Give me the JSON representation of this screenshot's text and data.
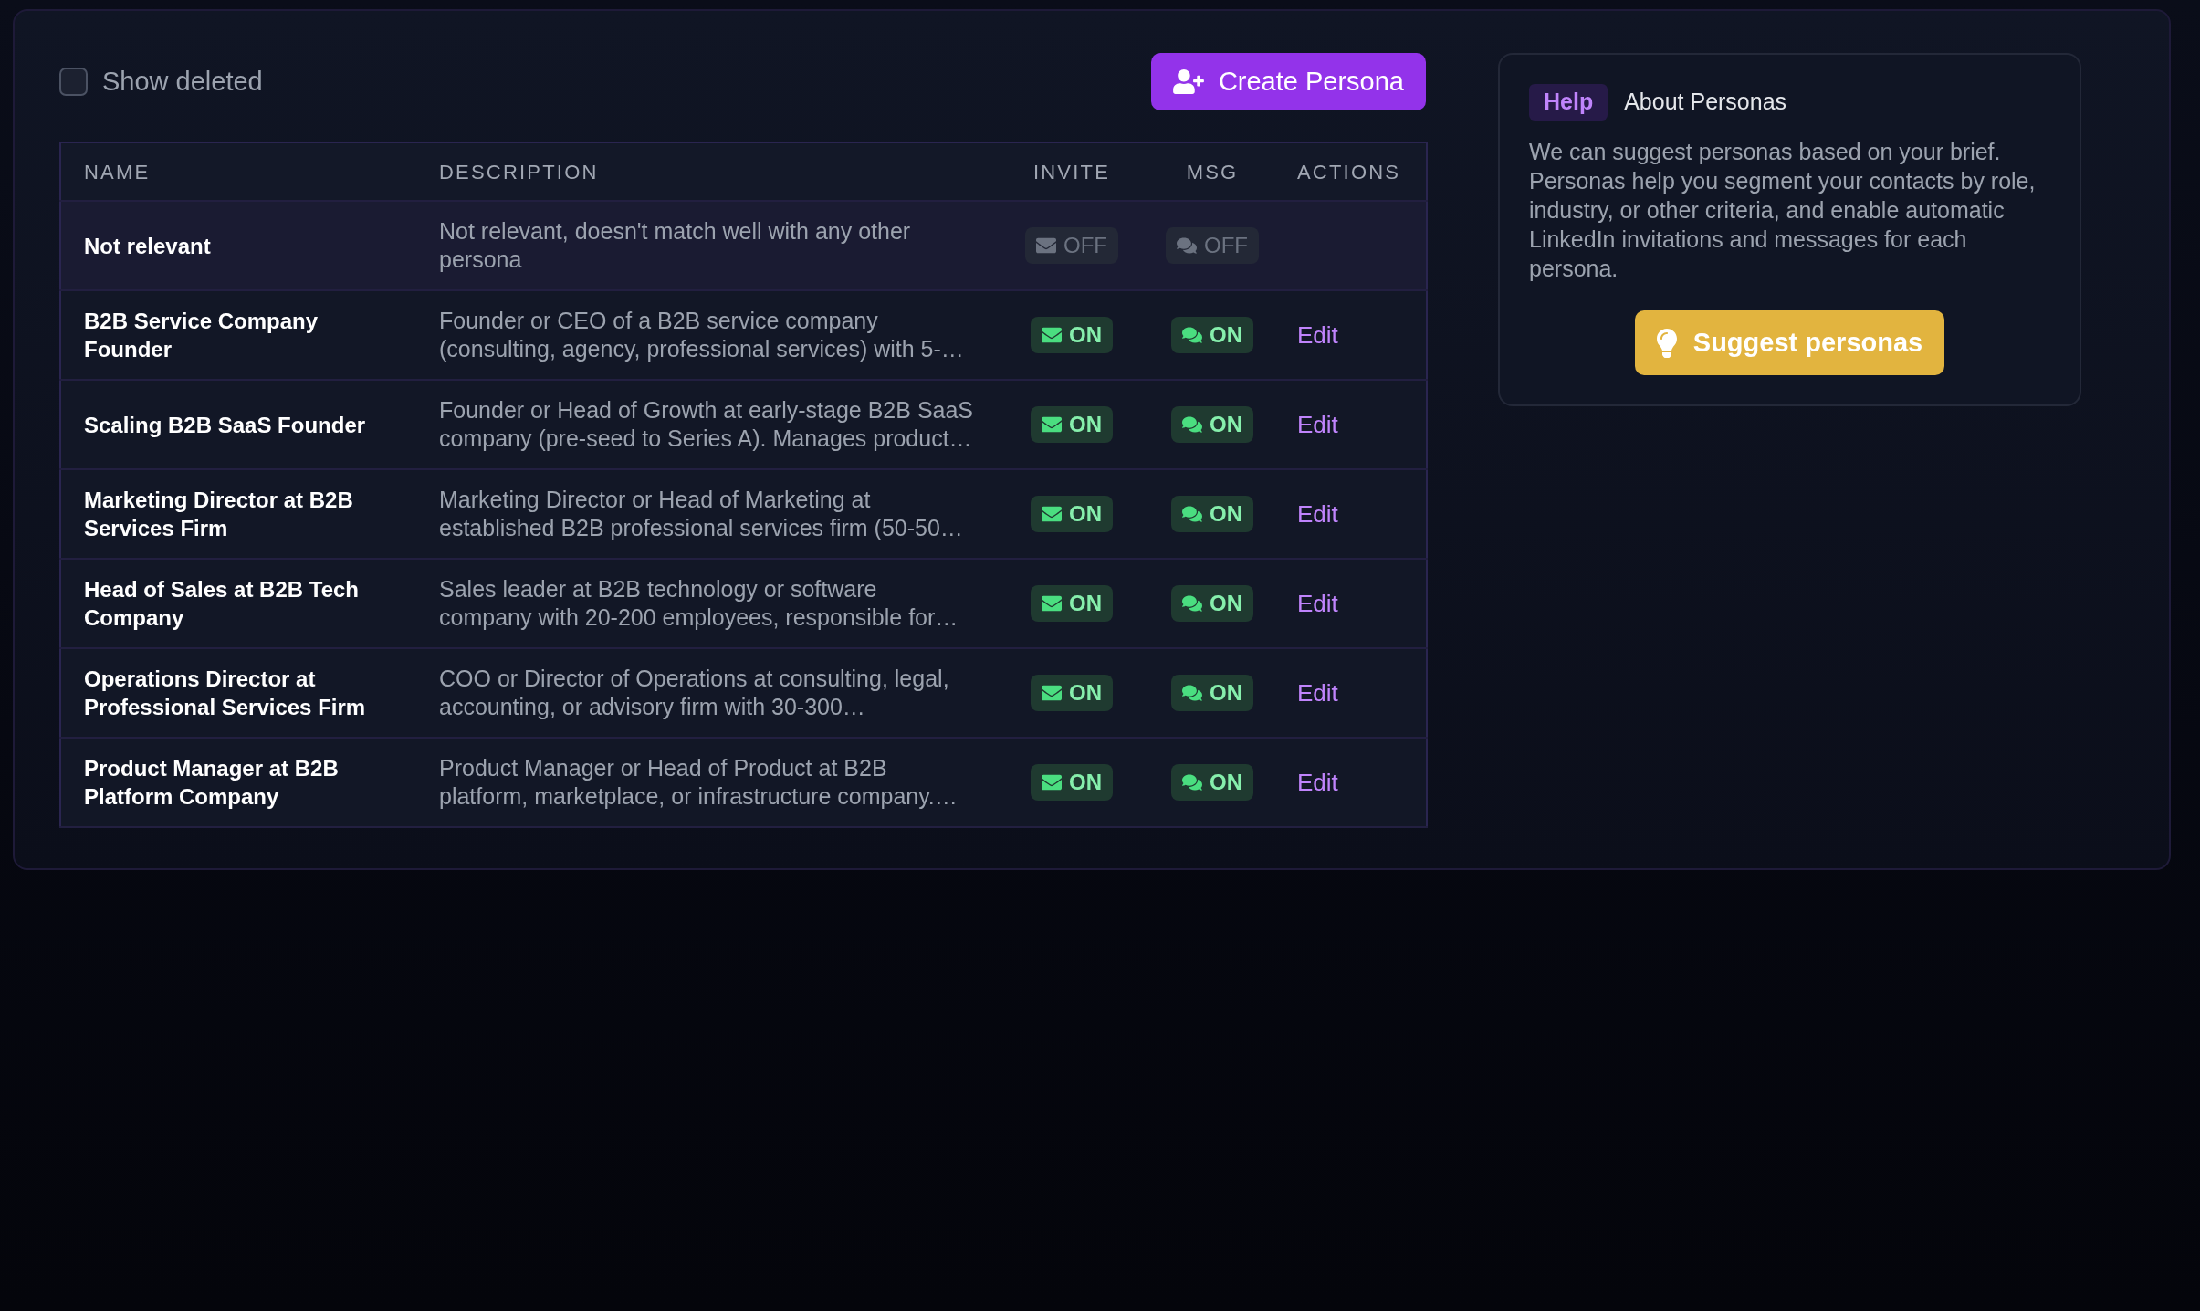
{
  "show_deleted": {
    "label": "Show deleted",
    "checked": false
  },
  "create_button": {
    "label": "Create Persona"
  },
  "table": {
    "columns": [
      "NAME",
      "DESCRIPTION",
      "INVITE",
      "MSG",
      "ACTIONS"
    ],
    "rows": [
      {
        "name": "Not relevant",
        "description": "Not relevant, doesn't match well with any other persona",
        "highlighted": true,
        "invite": {
          "label": "OFF",
          "on": false
        },
        "msg": {
          "label": "OFF",
          "on": false
        }
      },
      {
        "name": "B2B Service Company Founder",
        "description": "Founder or CEO of a B2B service company (consulting, agency, professional services) with 5-…",
        "highlighted": false,
        "invite": {
          "label": "ON",
          "on": true
        },
        "msg": {
          "label": "ON",
          "on": true
        },
        "action": "Edit"
      },
      {
        "name": "Scaling B2B SaaS Founder",
        "description": "Founder or Head of Growth at early-stage B2B SaaS company (pre-seed to Series A). Manages product…",
        "highlighted": false,
        "invite": {
          "label": "ON",
          "on": true
        },
        "msg": {
          "label": "ON",
          "on": true
        },
        "action": "Edit"
      },
      {
        "name": "Marketing Director at B2B Services Firm",
        "description": "Marketing Director or Head of Marketing at established B2B professional services firm (50-50…",
        "highlighted": false,
        "invite": {
          "label": "ON",
          "on": true
        },
        "msg": {
          "label": "ON",
          "on": true
        },
        "action": "Edit"
      },
      {
        "name": "Head of Sales at B2B Tech Company",
        "description": "Sales leader at B2B technology or software company with 20-200 employees, responsible for…",
        "highlighted": false,
        "invite": {
          "label": "ON",
          "on": true
        },
        "msg": {
          "label": "ON",
          "on": true
        },
        "action": "Edit"
      },
      {
        "name": "Operations Director at Professional Services Firm",
        "description": "COO or Director of Operations at consulting, legal, accounting, or advisory firm with 30-300…",
        "highlighted": false,
        "invite": {
          "label": "ON",
          "on": true
        },
        "msg": {
          "label": "ON",
          "on": true
        },
        "action": "Edit"
      },
      {
        "name": "Product Manager at B2B Platform Company",
        "description": "Product Manager or Head of Product at B2B platform, marketplace, or infrastructure company.…",
        "highlighted": false,
        "invite": {
          "label": "ON",
          "on": true
        },
        "msg": {
          "label": "ON",
          "on": true
        },
        "action": "Edit"
      }
    ]
  },
  "help": {
    "tag": "Help",
    "title": "About Personas",
    "text": "We can suggest personas based on your brief. Personas help you segment your contacts by role, industry, or other criteria, and enable automatic LinkedIn invitations and messages for each persona.",
    "button": "Suggest personas"
  }
}
